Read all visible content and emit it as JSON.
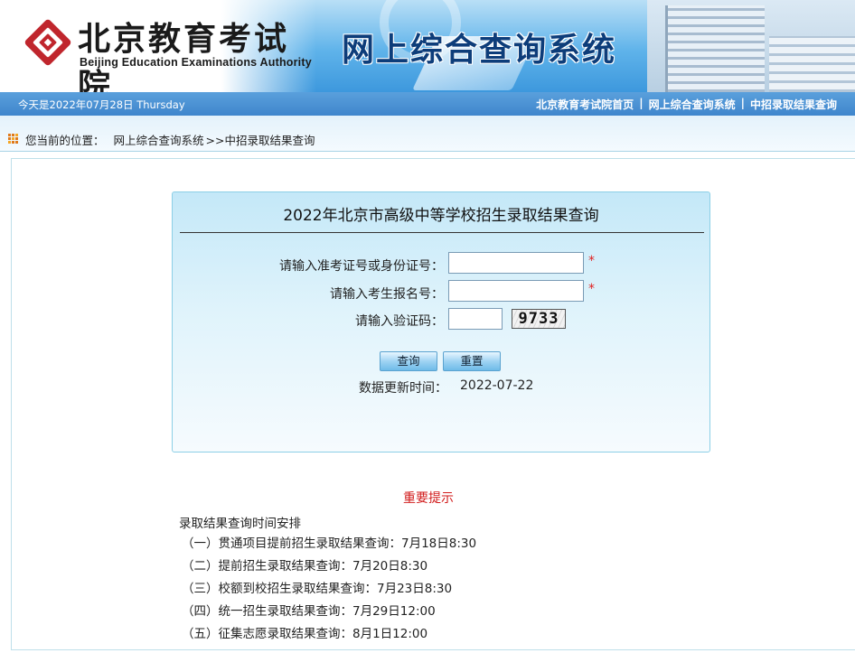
{
  "header": {
    "org_name_cn": "北京教育考试院",
    "org_name_en": "Beijing Education Examinations Authority",
    "system_title": "网上综合查询系统",
    "logo_icon": "beijing-education-logo-icon",
    "brand_color": "#c0262d"
  },
  "navbar": {
    "date_text": "今天是2022年07月28日 Thursday",
    "links": [
      {
        "label": "北京教育考试院首页"
      },
      {
        "label": "网上综合查询系统"
      },
      {
        "label": "中招录取结果查询"
      }
    ],
    "separator": "|"
  },
  "breadcrumb": {
    "prefix": "您当前的位置：",
    "items": [
      "网上综合查询系统",
      ">>中招录取结果查询"
    ]
  },
  "query_form": {
    "title": "2022年北京市高级中等学校招生录取结果查询",
    "fields": [
      {
        "label": "请输入准考证号或身份证号：",
        "value": "",
        "required_mark": "*"
      },
      {
        "label": "请输入考生报名号：",
        "value": "",
        "required_mark": "*"
      },
      {
        "label": "请输入验证码：",
        "value": ""
      }
    ],
    "captcha_text": "9733",
    "buttons": {
      "submit": "查询",
      "reset": "重置"
    },
    "updated_label": "数据更新时间：",
    "updated_value": "2022-07-22"
  },
  "notice": {
    "title": "重要提示",
    "subtitle": "录取结果查询时间安排",
    "items": [
      "（一）贯通项目提前招生录取结果查询：7月18日8:30",
      "（二）提前招生录取结果查询：7月20日8:30",
      "（三）校额到校招生录取结果查询：7月23日8:30",
      "（四）统一招生录取结果查询：7月29日12:00",
      "（五）征集志愿录取结果查询：8月1日12:00"
    ]
  },
  "colors": {
    "nav_blue": "#3f86cc",
    "title_navy": "#0d3d7a",
    "notice_red": "#d11a1a",
    "required_red": "#e02020"
  }
}
